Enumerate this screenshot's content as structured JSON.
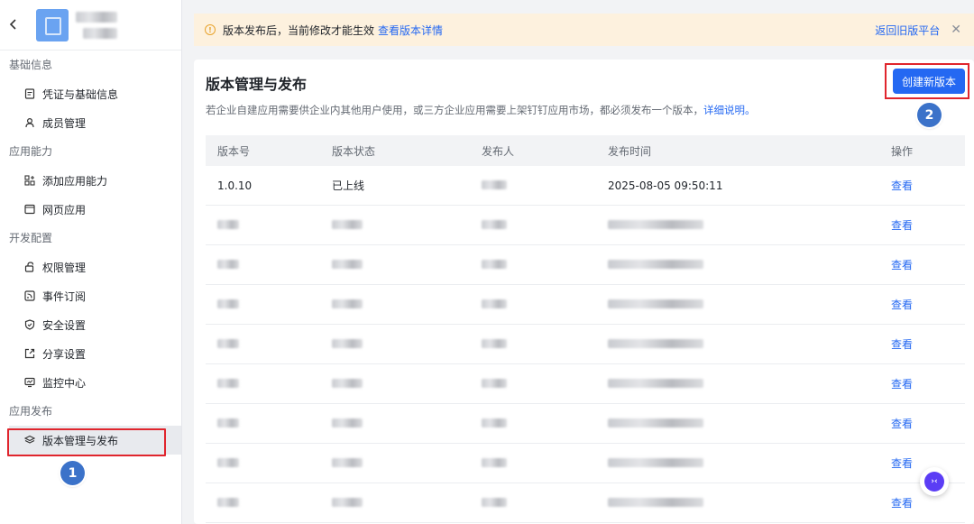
{
  "sidebar": {
    "back_icon": "chevron-left-icon",
    "sections": [
      {
        "title": "基础信息",
        "items": [
          {
            "label": "凭证与基础信息",
            "icon": "document-icon"
          },
          {
            "label": "成员管理",
            "icon": "user-icon"
          }
        ]
      },
      {
        "title": "应用能力",
        "items": [
          {
            "label": "添加应用能力",
            "icon": "grid-plus-icon"
          },
          {
            "label": "网页应用",
            "icon": "browser-icon"
          }
        ]
      },
      {
        "title": "开发配置",
        "items": [
          {
            "label": "权限管理",
            "icon": "lock-icon"
          },
          {
            "label": "事件订阅",
            "icon": "rss-icon"
          },
          {
            "label": "安全设置",
            "icon": "shield-icon"
          },
          {
            "label": "分享设置",
            "icon": "share-icon"
          },
          {
            "label": "监控中心",
            "icon": "monitor-icon"
          }
        ]
      },
      {
        "title": "应用发布",
        "items": [
          {
            "label": "版本管理与发布",
            "icon": "layers-icon",
            "active": true
          }
        ]
      }
    ]
  },
  "banner": {
    "message": "版本发布后，当前修改才能生效",
    "link": "查看版本详情",
    "right_link": "返回旧版平台",
    "close_icon": "close-icon"
  },
  "main": {
    "title": "版本管理与发布",
    "description": "若企业自建应用需要供企业内其他用户使用，或三方企业应用需要上架钉钉应用市场，都必须发布一个版本，",
    "description_link": "详细说明。",
    "create_button": "创建新版本",
    "table": {
      "headers": [
        "版本号",
        "版本状态",
        "发布人",
        "发布时间",
        "操作"
      ],
      "first_row": {
        "version": "1.0.10",
        "status": "已上线",
        "time": "2025-08-05 09:50:11"
      },
      "action_label": "查看"
    }
  },
  "annotations": {
    "marker_1": "1",
    "marker_2": "2"
  },
  "colors": {
    "accent": "#2468f2",
    "highlight": "#e0252d",
    "marker": "#3b72c9",
    "banner_bg": "#fdf1de"
  }
}
